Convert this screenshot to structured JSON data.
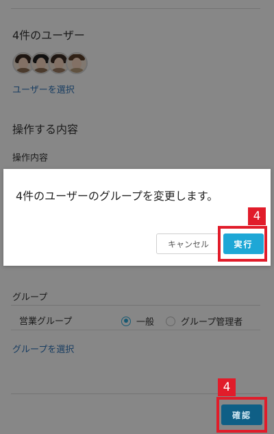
{
  "users": {
    "title": "4件のユーザー",
    "select_link": "ユーザーを選択"
  },
  "operations": {
    "title": "操作する内容",
    "field_label": "操作内容"
  },
  "group": {
    "label": "グループ",
    "rows": [
      {
        "name": "営業グループ",
        "options": [
          "一般",
          "グループ管理者"
        ],
        "selected": "一般"
      }
    ],
    "select_link": "グループを選択"
  },
  "dialog": {
    "message": "4件のユーザーのグループを変更します。",
    "cancel_label": "キャンセル",
    "execute_label": "実行"
  },
  "footer": {
    "confirm_label": "確認"
  },
  "annotations": {
    "execute_step": "4",
    "confirm_step": "4"
  },
  "colors": {
    "accent": "#1ea7d6",
    "link": "#2e73b8",
    "annotation": "#e11c2a"
  }
}
